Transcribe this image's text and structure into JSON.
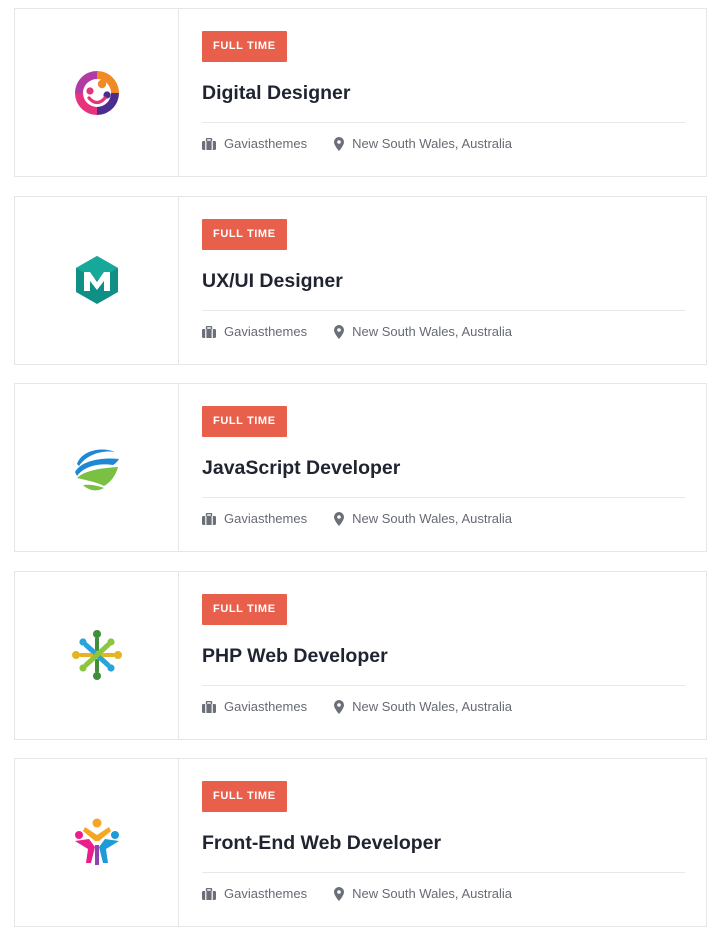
{
  "jobs": [
    {
      "logo": "circle-people-logo-icon",
      "badge": "FULL TIME",
      "title": "Digital Designer",
      "company": "Gaviasthemes",
      "location": "New South Wales, Australia"
    },
    {
      "logo": "teal-hexagon-m-logo-icon",
      "badge": "FULL TIME",
      "title": "UX/UI Designer",
      "company": "Gaviasthemes",
      "location": "New South Wales, Australia"
    },
    {
      "logo": "swoosh-globe-logo-icon",
      "badge": "FULL TIME",
      "title": "JavaScript Developer",
      "company": "Gaviasthemes",
      "location": "New South Wales, Australia"
    },
    {
      "logo": "community-circle-logo-icon",
      "badge": "FULL TIME",
      "title": "PHP Web Developer",
      "company": "Gaviasthemes",
      "location": "New South Wales, Australia"
    },
    {
      "logo": "colorful-people-logo-icon",
      "badge": "FULL TIME",
      "title": "Front-End Web Developer",
      "company": "Gaviasthemes",
      "location": "New South Wales, Australia"
    }
  ],
  "icons": {
    "company": "briefcase-icon",
    "location": "map-pin-icon"
  },
  "colors": {
    "badge_background": "#e8604c",
    "badge_text": "#ffffff",
    "title_text": "#1f2430",
    "meta_text": "#666a73",
    "border": "#e6e6e6"
  }
}
